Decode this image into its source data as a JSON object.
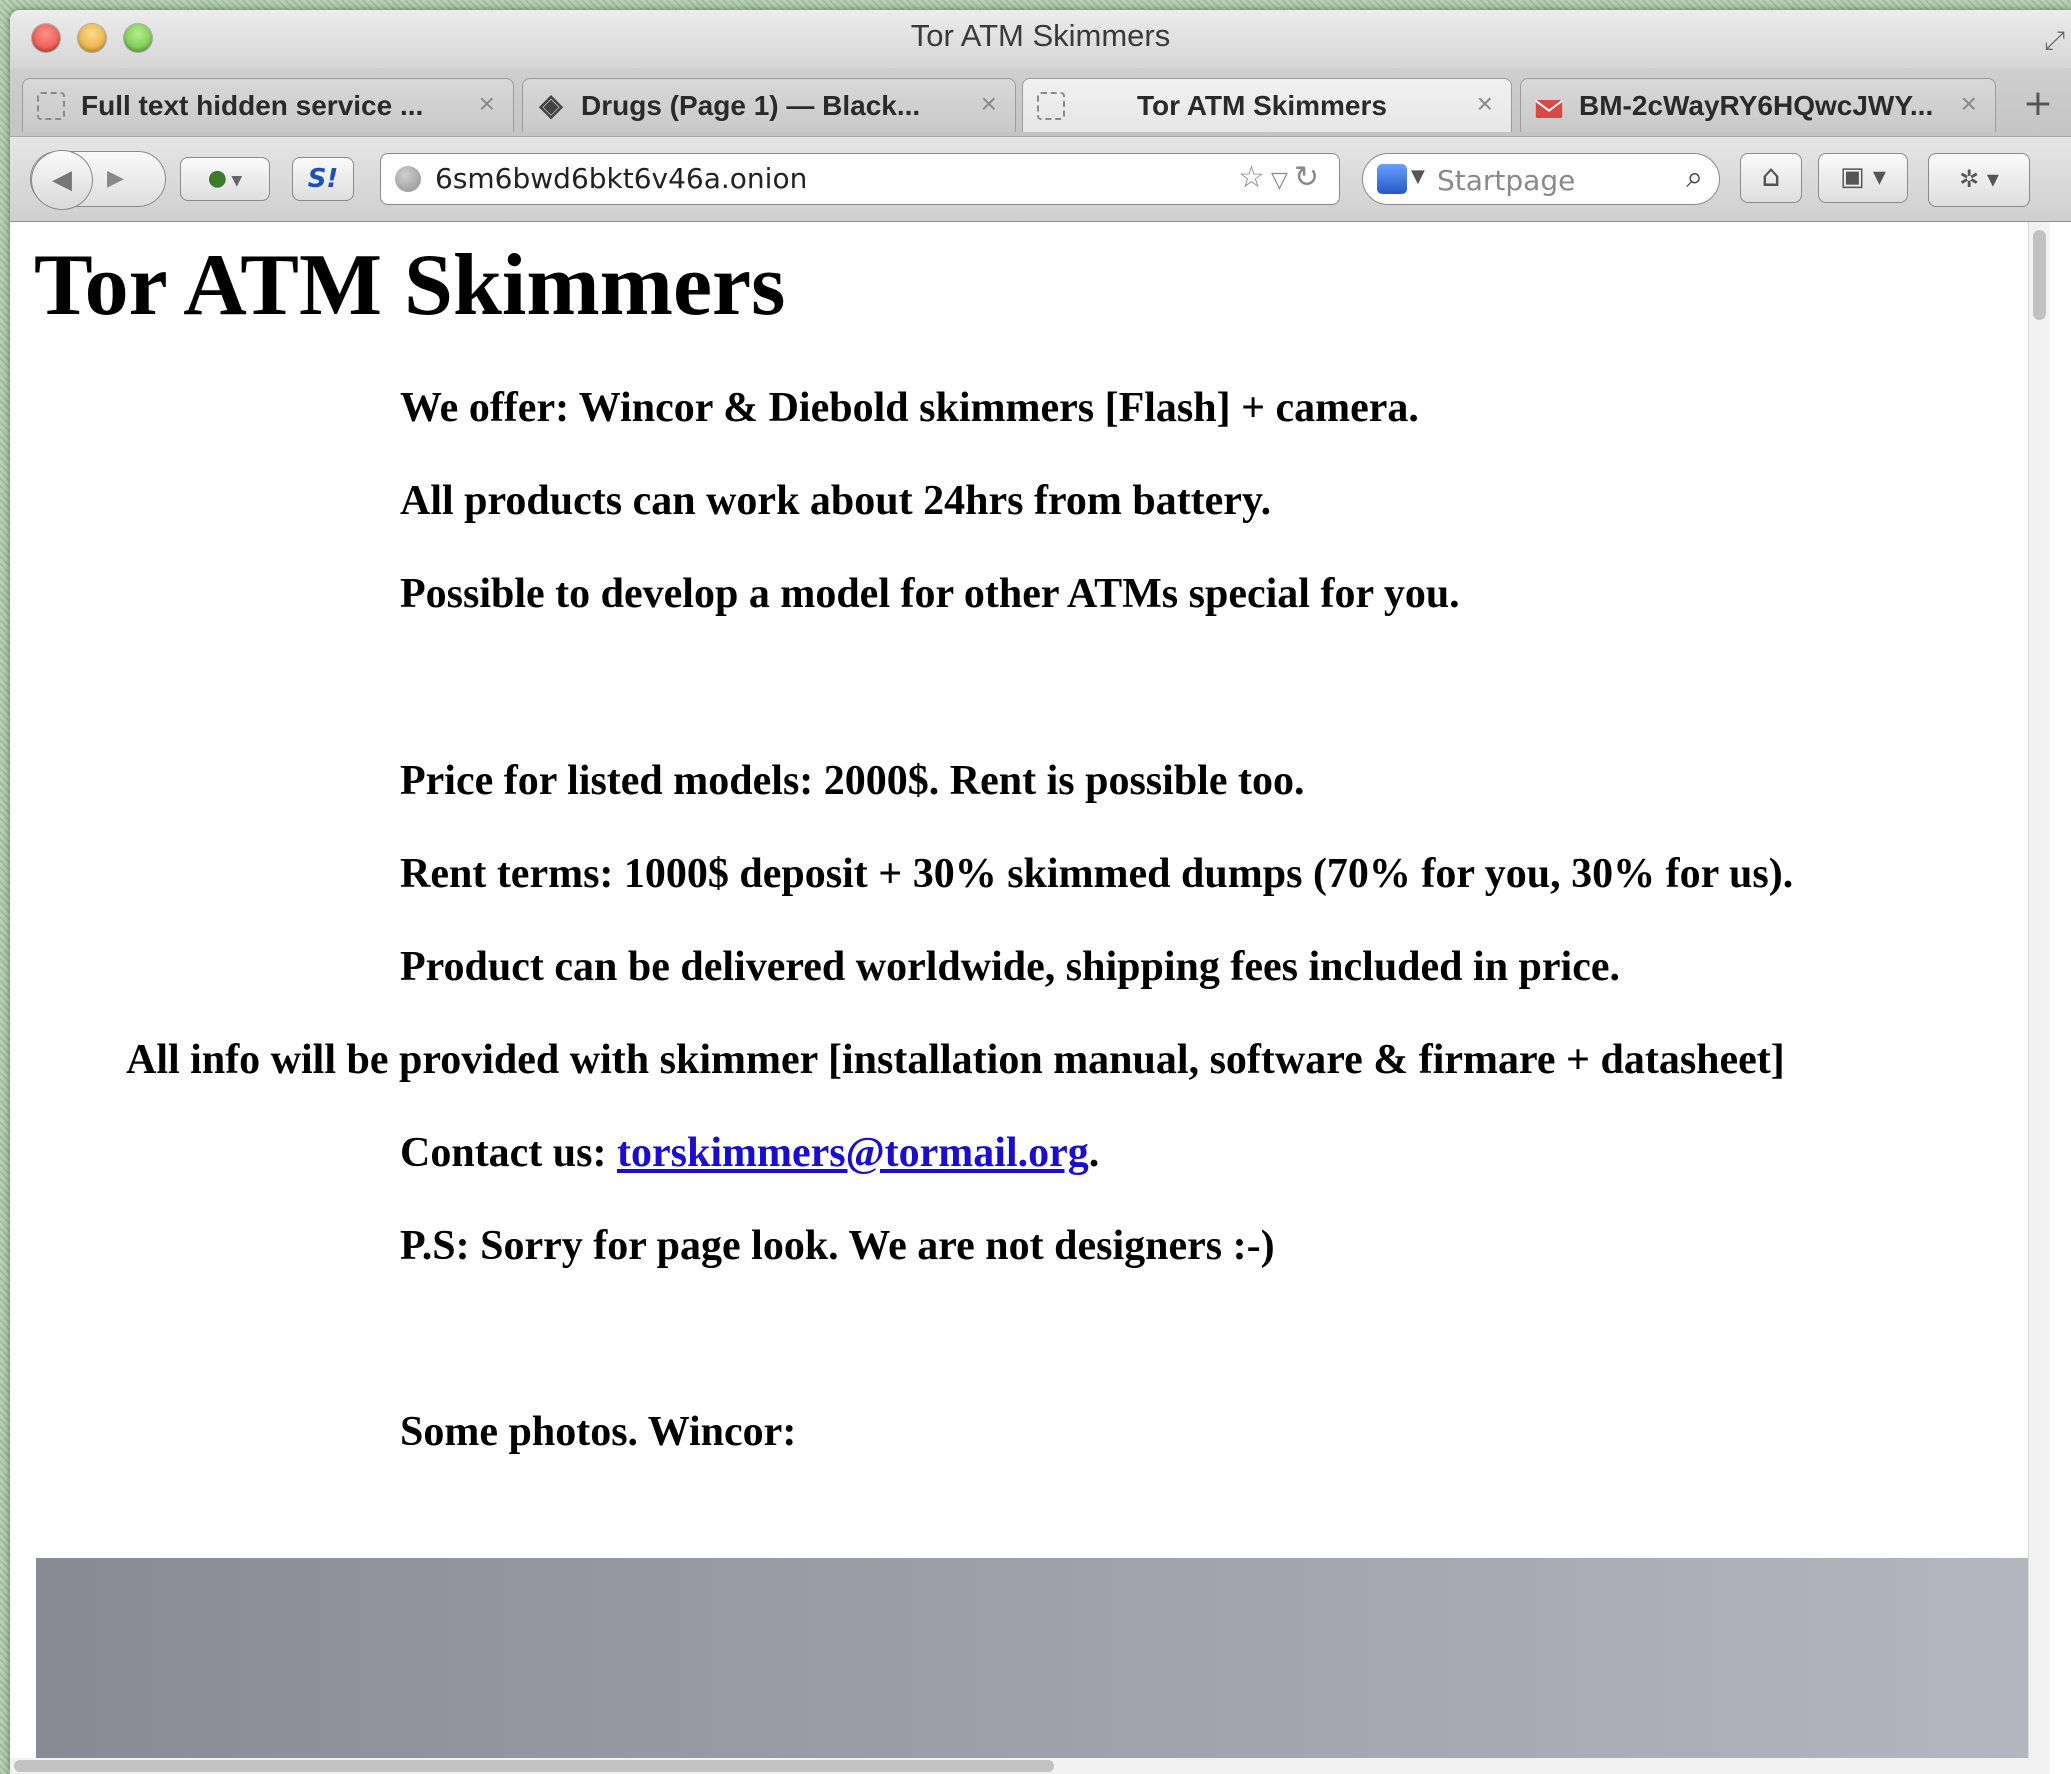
{
  "window": {
    "title": "Tor ATM Skimmers"
  },
  "tabs": [
    {
      "label": "Full text hidden service ...",
      "active": false
    },
    {
      "label": "Drugs (Page 1) — Black...",
      "active": false
    },
    {
      "label": "Tor ATM Skimmers",
      "active": true
    },
    {
      "label": "BM-2cWayRY6HQwcJWY...",
      "active": false
    }
  ],
  "tab_close_glyph": "×",
  "new_tab_glyph": "+",
  "navbar": {
    "url": "6sm6bwd6bkt6v46a.onion",
    "search_placeholder": "Startpage",
    "s_button_label": "S!"
  },
  "page": {
    "title": "Tor ATM Skimmers",
    "paragraphs": [
      "We offer: Wincor & Diebold skimmers [Flash] + camera.",
      "All products can work about 24hrs from battery.",
      "Possible to develop a model for other ATMs special for you.",
      "Price for listed models: 2000$. Rent is possible too.",
      "Rent terms: 1000$ deposit + 30% skimmed dumps (70% for you, 30% for us).",
      "Product can be delivered worldwide, shipping fees included in price.",
      "All info will be provided with skimmer [installation manual, software & firmare + datasheet]"
    ],
    "contact_prefix": "Contact us: ",
    "contact_email": "torskimmers@tormail.org",
    "contact_suffix": ".",
    "ps": "P.S: Sorry for page look. We are not designers :-)",
    "photos_caption": "Some photos. Wincor:"
  },
  "colors": {
    "link": "#1a0dcc",
    "mail_icon": "#d94848"
  },
  "icons": [
    "back-icon",
    "forward-icon",
    "tor-onion-icon",
    "star-icon",
    "reload-icon",
    "search-icon",
    "home-icon",
    "bookmarks-icon",
    "addon-icon"
  ]
}
